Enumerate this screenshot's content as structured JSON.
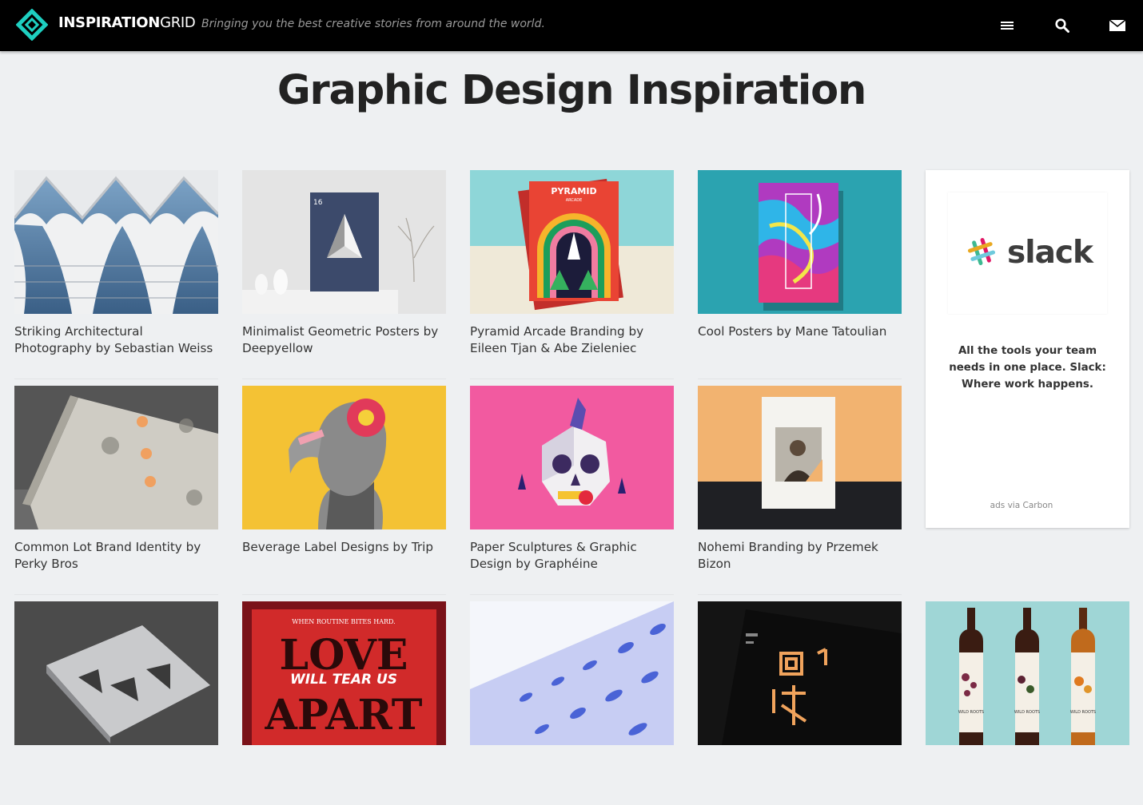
{
  "header": {
    "brand_bold": "INSPIRATION",
    "brand_light": "GRID",
    "tagline": "Bringing you the best creative stories from around the world.",
    "icons": [
      "menu-icon",
      "search-icon",
      "mail-icon"
    ],
    "logo_color": "#1ecfc0"
  },
  "page": {
    "title": "Graphic Design Inspiration",
    "background": "#eef0f2"
  },
  "cards": [
    {
      "title": "Striking Architectural Photography by Sebastian Weiss"
    },
    {
      "title": "Minimalist Geometric Posters by Deepyellow"
    },
    {
      "title": "Pyramid Arcade Branding by Eileen Tjan & Abe Zieleniec"
    },
    {
      "title": "Cool Posters by Mane Tatoulian"
    },
    {
      "title": "Common Lot Brand Identity by Perky Bros"
    },
    {
      "title": "Beverage Label Designs by Trip"
    },
    {
      "title": "Paper Sculptures & Graphic Design by Graphéine"
    },
    {
      "title": "Nohemi Branding by Przemek Bizon"
    },
    {
      "title": ""
    },
    {
      "title": ""
    },
    {
      "title": ""
    },
    {
      "title": ""
    },
    {
      "title": ""
    }
  ],
  "thumb_text": {
    "poster_number": "16",
    "pyramid_title": "PYRAMID",
    "pyramid_sub": "ARCADE",
    "love_tag": "WHEN ROUTINE BITES HARD.",
    "love_top": "LOVE",
    "love_mid": "WILL TEAR US",
    "love_bot": "APART",
    "bottle_label": "WILD ROOTS"
  },
  "ad": {
    "logo_text": "slack",
    "text": "All the tools your team needs in one place. Slack: Where work happens.",
    "via": "ads via Carbon"
  }
}
